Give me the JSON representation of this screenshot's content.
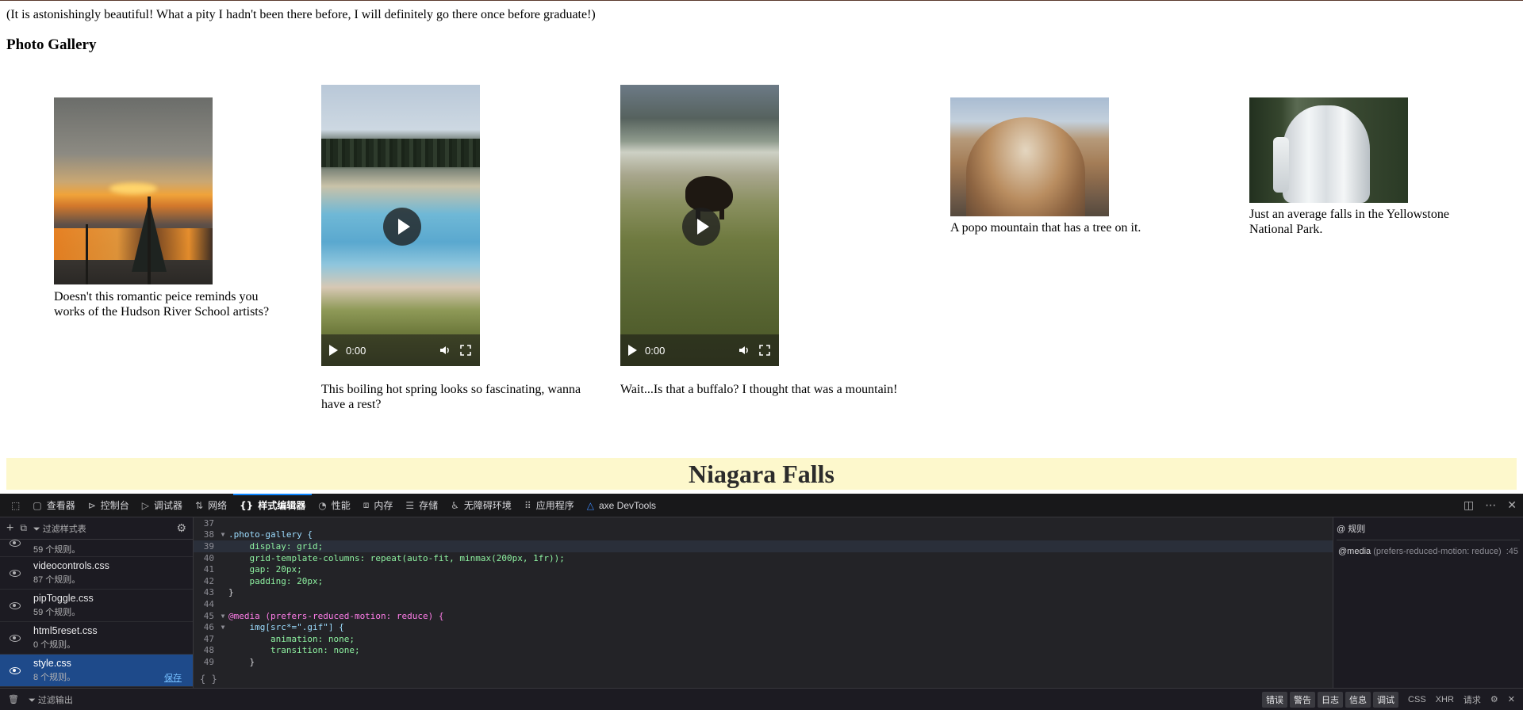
{
  "page": {
    "intro": "(It is astonishingly beautiful! What a pity I hadn't been there before, I will definitely go there once before graduate!)",
    "gallery_title": "Photo Gallery",
    "items": [
      {
        "caption": "Doesn't this romantic peice reminds you works of the Hudson River School artists?"
      },
      {
        "caption": "This boiling hot spring looks so fascinating, wanna have a rest?",
        "video_time": "0:00"
      },
      {
        "caption": "Wait...Is that a buffalo? I thought that was a mountain!",
        "video_time": "0:00"
      },
      {
        "caption": "A popo mountain that has a tree on it."
      },
      {
        "caption": "Just an average falls in the Yellowstone National Park."
      }
    ],
    "banner": "Niagara Falls",
    "banner_color": "#fdf8cc"
  },
  "devtools": {
    "tabs": [
      {
        "icon": "inspector-icon",
        "label": "查看器"
      },
      {
        "icon": "console-icon",
        "label": "控制台"
      },
      {
        "icon": "debugger-icon",
        "label": "调试器"
      },
      {
        "icon": "network-icon",
        "label": "网络"
      },
      {
        "icon": "style-editor-icon",
        "label": "样式编辑器"
      },
      {
        "icon": "performance-icon",
        "label": "性能"
      },
      {
        "icon": "memory-icon",
        "label": "内存"
      },
      {
        "icon": "storage-icon",
        "label": "存储"
      },
      {
        "icon": "accessibility-icon",
        "label": "无障碍环境"
      },
      {
        "icon": "application-icon",
        "label": "应用程序"
      },
      {
        "icon": "axe-icon",
        "label": "axe DevTools"
      }
    ],
    "active_tab": "样式编辑器",
    "filter_placeholder": "过滤样式表",
    "sheets": [
      {
        "name": "",
        "count": "59 个规则。"
      },
      {
        "name": "videocontrols.css",
        "count": "87 个规则。"
      },
      {
        "name": "pipToggle.css",
        "count": "59 个规则。"
      },
      {
        "name": "html5reset.css",
        "count": "0 个规则。"
      },
      {
        "name": "style.css",
        "count": "8 个规则。",
        "selected": true
      }
    ],
    "save_label": "保存",
    "code_lines": [
      {
        "n": "37",
        "text": ""
      },
      {
        "n": "38",
        "text": ".photo-gallery {"
      },
      {
        "n": "39",
        "text": "    display: grid;"
      },
      {
        "n": "40",
        "text": "    grid-template-columns: repeat(auto-fit, minmax(200px, 1fr));"
      },
      {
        "n": "41",
        "text": "    gap: 20px;"
      },
      {
        "n": "42",
        "text": "    padding: 20px;"
      },
      {
        "n": "43",
        "text": "}"
      },
      {
        "n": "44",
        "text": ""
      },
      {
        "n": "45",
        "text": "@media (prefers-reduced-motion: reduce) {"
      },
      {
        "n": "46",
        "text": "    img[src*=\".gif\"] {"
      },
      {
        "n": "47",
        "text": "        animation: none;"
      },
      {
        "n": "48",
        "text": "        transition: none;"
      },
      {
        "n": "49",
        "text": "    }"
      }
    ],
    "braces_label": "{ }",
    "rules_header": "@ 规则",
    "rule": {
      "at": "@media",
      "query": "(prefers-reduced-motion: reduce)",
      "line": ":45"
    },
    "footer": {
      "filter_output": "过滤输出",
      "chips": [
        "错误",
        "警告",
        "日志",
        "信息",
        "调试"
      ],
      "extras": [
        "CSS",
        "XHR",
        "请求"
      ]
    }
  }
}
